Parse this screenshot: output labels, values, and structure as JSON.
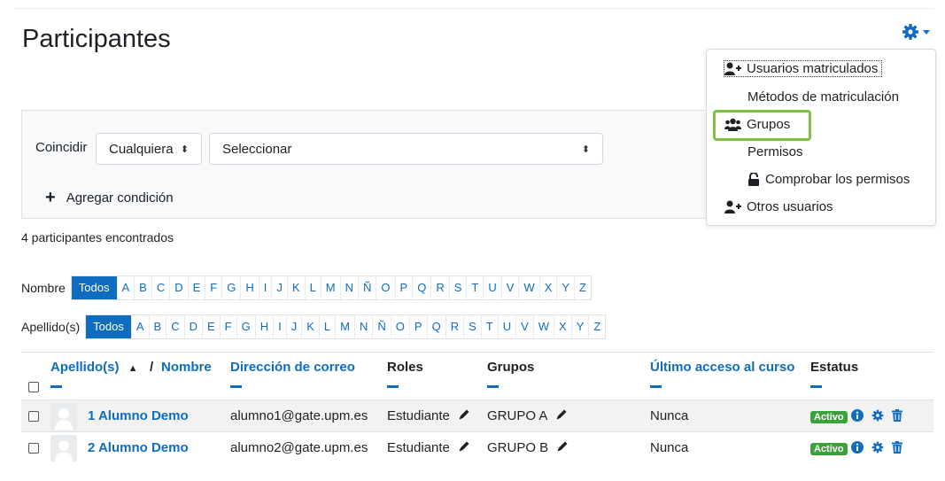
{
  "page": {
    "title": "Participantes"
  },
  "actions_menu": {
    "icon": "gear-icon",
    "items": [
      {
        "label": "Usuarios matriculados",
        "icon": "user-plus-icon"
      },
      {
        "label": "Métodos de matriculación",
        "icon": ""
      },
      {
        "label": "Grupos",
        "icon": "users-icon"
      },
      {
        "label": "Permisos",
        "icon": ""
      },
      {
        "label": "Comprobar los permisos",
        "icon": "unlock-icon"
      },
      {
        "label": "Otros usuarios",
        "icon": "user-plus-icon"
      }
    ]
  },
  "filter": {
    "match_label": "Coincidir",
    "match_value": "Cualquiera",
    "field_value": "Seleccionar",
    "add_condition": "Agregar condición"
  },
  "results": {
    "count_text": "4 participantes encontrados"
  },
  "initials_first": {
    "label": "Nombre",
    "letters": [
      "Todos",
      "A",
      "B",
      "C",
      "D",
      "E",
      "F",
      "G",
      "H",
      "I",
      "J",
      "K",
      "L",
      "M",
      "N",
      "Ñ",
      "O",
      "P",
      "Q",
      "R",
      "S",
      "T",
      "U",
      "V",
      "W",
      "X",
      "Y",
      "Z"
    ]
  },
  "initials_last": {
    "label": "Apellido(s)",
    "letters": [
      "Todos",
      "A",
      "B",
      "C",
      "D",
      "E",
      "F",
      "G",
      "H",
      "I",
      "J",
      "K",
      "L",
      "M",
      "N",
      "Ñ",
      "O",
      "P",
      "Q",
      "R",
      "S",
      "T",
      "U",
      "V",
      "W",
      "X",
      "Y",
      "Z"
    ]
  },
  "table": {
    "headers": {
      "apellido": "Apellido(s)",
      "sort_arrow": "▲",
      "separator": "/",
      "nombre": "Nombre",
      "email": "Dirección de correo",
      "roles": "Roles",
      "grupos": "Grupos",
      "ultimo_acceso": "Último acceso al curso",
      "estatus": "Estatus"
    },
    "rows": [
      {
        "name": "1 Alumno Demo",
        "email": "alumno1@gate.upm.es",
        "role": "Estudiante",
        "group": "GRUPO A",
        "last_access": "Nunca",
        "status": "Activo"
      },
      {
        "name": "2 Alumno Demo",
        "email": "alumno2@gate.upm.es",
        "role": "Estudiante",
        "group": "GRUPO B",
        "last_access": "Nunca",
        "status": "Activo"
      }
    ]
  },
  "colors": {
    "link": "#0f6cbf",
    "active_badge": "#3ba13b",
    "highlight": "#7dc242"
  }
}
